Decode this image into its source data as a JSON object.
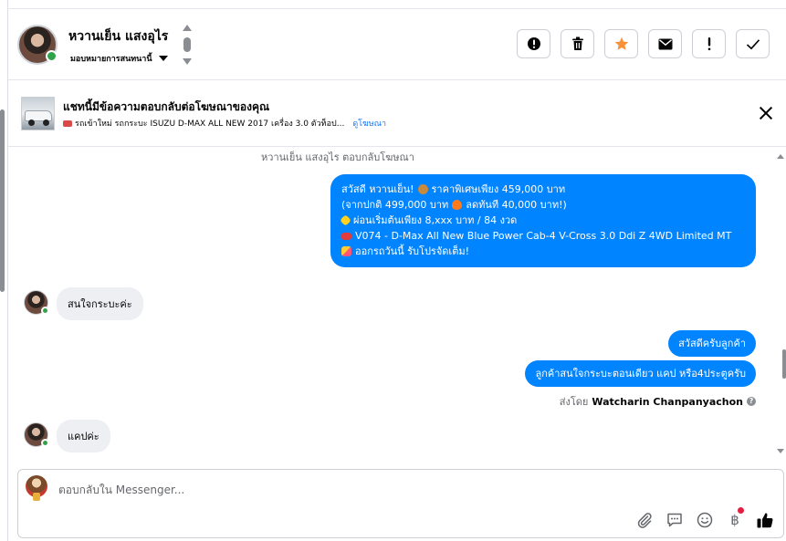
{
  "header": {
    "contact_name": "หวานเย็น แสงอุไร",
    "assign_label": "มอบหมายการสนทนานี้",
    "actions": [
      {
        "name": "report-button",
        "icon": "exclamation-circle-icon",
        "label": "!"
      },
      {
        "name": "delete-button",
        "icon": "trash-icon",
        "label": ""
      },
      {
        "name": "star-button",
        "icon": "star-icon",
        "label": ""
      },
      {
        "name": "mark-unread-button",
        "icon": "envelope-icon",
        "label": ""
      },
      {
        "name": "mark-important-button",
        "icon": "exclamation-icon",
        "label": "!"
      },
      {
        "name": "mark-done-button",
        "icon": "check-icon",
        "label": ""
      }
    ]
  },
  "banner": {
    "title": "แชทนี้มีข้อความตอบกลับต่อโฆษณาของคุณ",
    "subtitle": "รถเข้าใหม่ รถกระบะ ISUZU D-MAX ALL NEW 2017 เครื่อง 3.0 ตัวท็อป...",
    "link": "ดูโฆษณา"
  },
  "conversation": {
    "system_note": "หวานเย็น แสงอุไร ตอบกลับโฆษณา",
    "ad_message": {
      "line1_a": "สวัสดี หวานเย็น!",
      "line1_b": "ราคาพิเศษเพียง 459,000 บาท",
      "line2_a": "(จากปกติ 499,000 บาท",
      "line2_b": "ลดทันที 40,000 บาท!)",
      "line3": "ผ่อนเริ่มต้นเพียง 8,xxx บาท / 84 งวด",
      "line4": "V074 - D-Max All New Blue Power Cab-4 V-Cross 3.0 Ddi Z 4WD Limited MT",
      "line5": "ออกรถวันนี้ รับโปรจัดเต็ม!"
    },
    "incoming_1": "สนใจกระบะค่ะ",
    "outgoing_1": "สวัสดีครับลูกค้า",
    "outgoing_2": "ลูกค้าสนใจกระบะตอนเดียว แคป หรือ4ประตูครับ",
    "sent_by_prefix": "ส่งโดย",
    "sent_by_name": "Watcharin Chanpanyachon",
    "incoming_2": "แคปค่ะ"
  },
  "composer": {
    "placeholder": "ตอบกลับใน Messenger...",
    "value": "",
    "tools": [
      "paperclip-icon",
      "saved-reply-icon",
      "emoji-icon",
      "baht-icon",
      "thumbs-up-icon"
    ],
    "baht_symbol": "฿"
  },
  "colors": {
    "messenger_blue": "#0084ff",
    "star_orange": "#f7923a",
    "link_blue": "#1877f2"
  }
}
